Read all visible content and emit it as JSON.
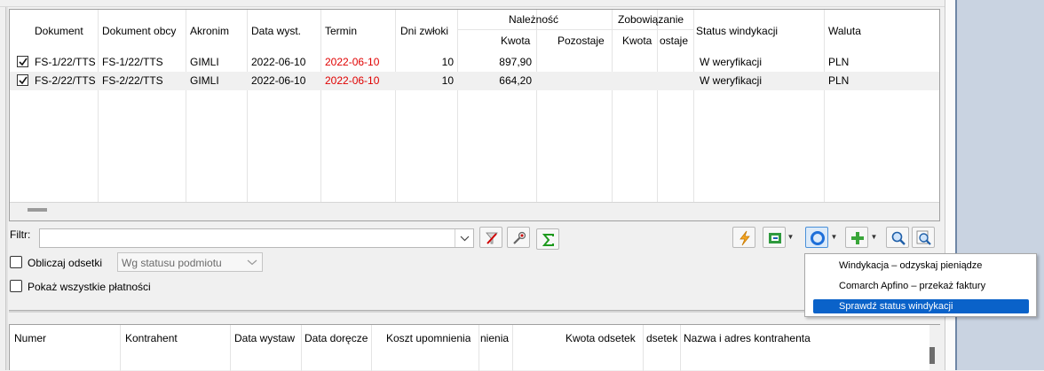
{
  "grid": {
    "headers": {
      "dokument": "Dokument",
      "dokument_obcy": "Dokument obcy",
      "akronim": "Akronim",
      "data_wyst": "Data wyst.",
      "termin": "Termin",
      "dni_zwloki": "Dni zwłoki",
      "naleznosc": "Należność",
      "naleznosc_kwota": "Kwota",
      "naleznosc_pozostaje": "Pozostaje",
      "zobowiazanie": "Zobowiązanie",
      "zobowiazanie_kwota": "Kwota",
      "zobowiazanie_pozostaje": "ostaje",
      "status_windykacji": "Status windykacji",
      "waluta": "Waluta"
    },
    "rows": [
      {
        "checked": true,
        "dokument": "FS-1/22/TTS",
        "dokument_obcy": "FS-1/22/TTS",
        "akronim": "GIMLI",
        "data_wyst": "2022-06-10",
        "termin": "2022-06-10",
        "dni_zwloki": "10",
        "kwota": "897,90",
        "status": "W weryfikacji",
        "waluta": "PLN"
      },
      {
        "checked": true,
        "dokument": "FS-2/22/TTS",
        "dokument_obcy": "FS-2/22/TTS",
        "akronim": "GIMLI",
        "data_wyst": "2022-06-10",
        "termin": "2022-06-10",
        "dni_zwloki": "10",
        "kwota": "664,20",
        "status": "W weryfikacji",
        "waluta": "PLN"
      }
    ]
  },
  "filter": {
    "label": "Filtr:",
    "value": "",
    "placeholder": ""
  },
  "options": {
    "oblicz_odsetki_label": "Obliczaj odsetki",
    "oblicz_odsetki_checked": false,
    "status_select_value": "Wg statusu podmiotu",
    "pokaz_platnosci_label": "Pokaż wszystkie płatności",
    "pokaz_platnosci_checked": false
  },
  "popup_menu": {
    "items": [
      {
        "label": "Windykacja – odzyskaj pieniądze",
        "selected": false
      },
      {
        "label": "Comarch Apfino – przekaż faktury",
        "selected": false
      },
      {
        "label": "Sprawdź status windykacji",
        "selected": true
      }
    ]
  },
  "grid2": {
    "headers": {
      "numer": "Numer",
      "kontrahent": "Kontrahent",
      "data_wystaw": "Data wystaw",
      "data_doreczenia": "Data doręcze",
      "koszt_upomnienia": "Koszt upomnienia",
      "upomnienia": "nienia",
      "kwota_odsetek": "Kwota odsetek",
      "odsetek": "dsetek",
      "nazwa_adres": "Nazwa i adres kontrahenta"
    }
  },
  "colors": {
    "accent": "#0a62c9",
    "overdue_date": "#e00000",
    "alt_row": "#f0f0f0"
  },
  "icons": [
    "checkmark-icon",
    "filter-clear-icon",
    "filter-settings-icon",
    "sigma-icon",
    "lightning-icon",
    "export-icon",
    "circle-ring-icon",
    "plus-icon",
    "search-icon",
    "search-preview-icon"
  ]
}
